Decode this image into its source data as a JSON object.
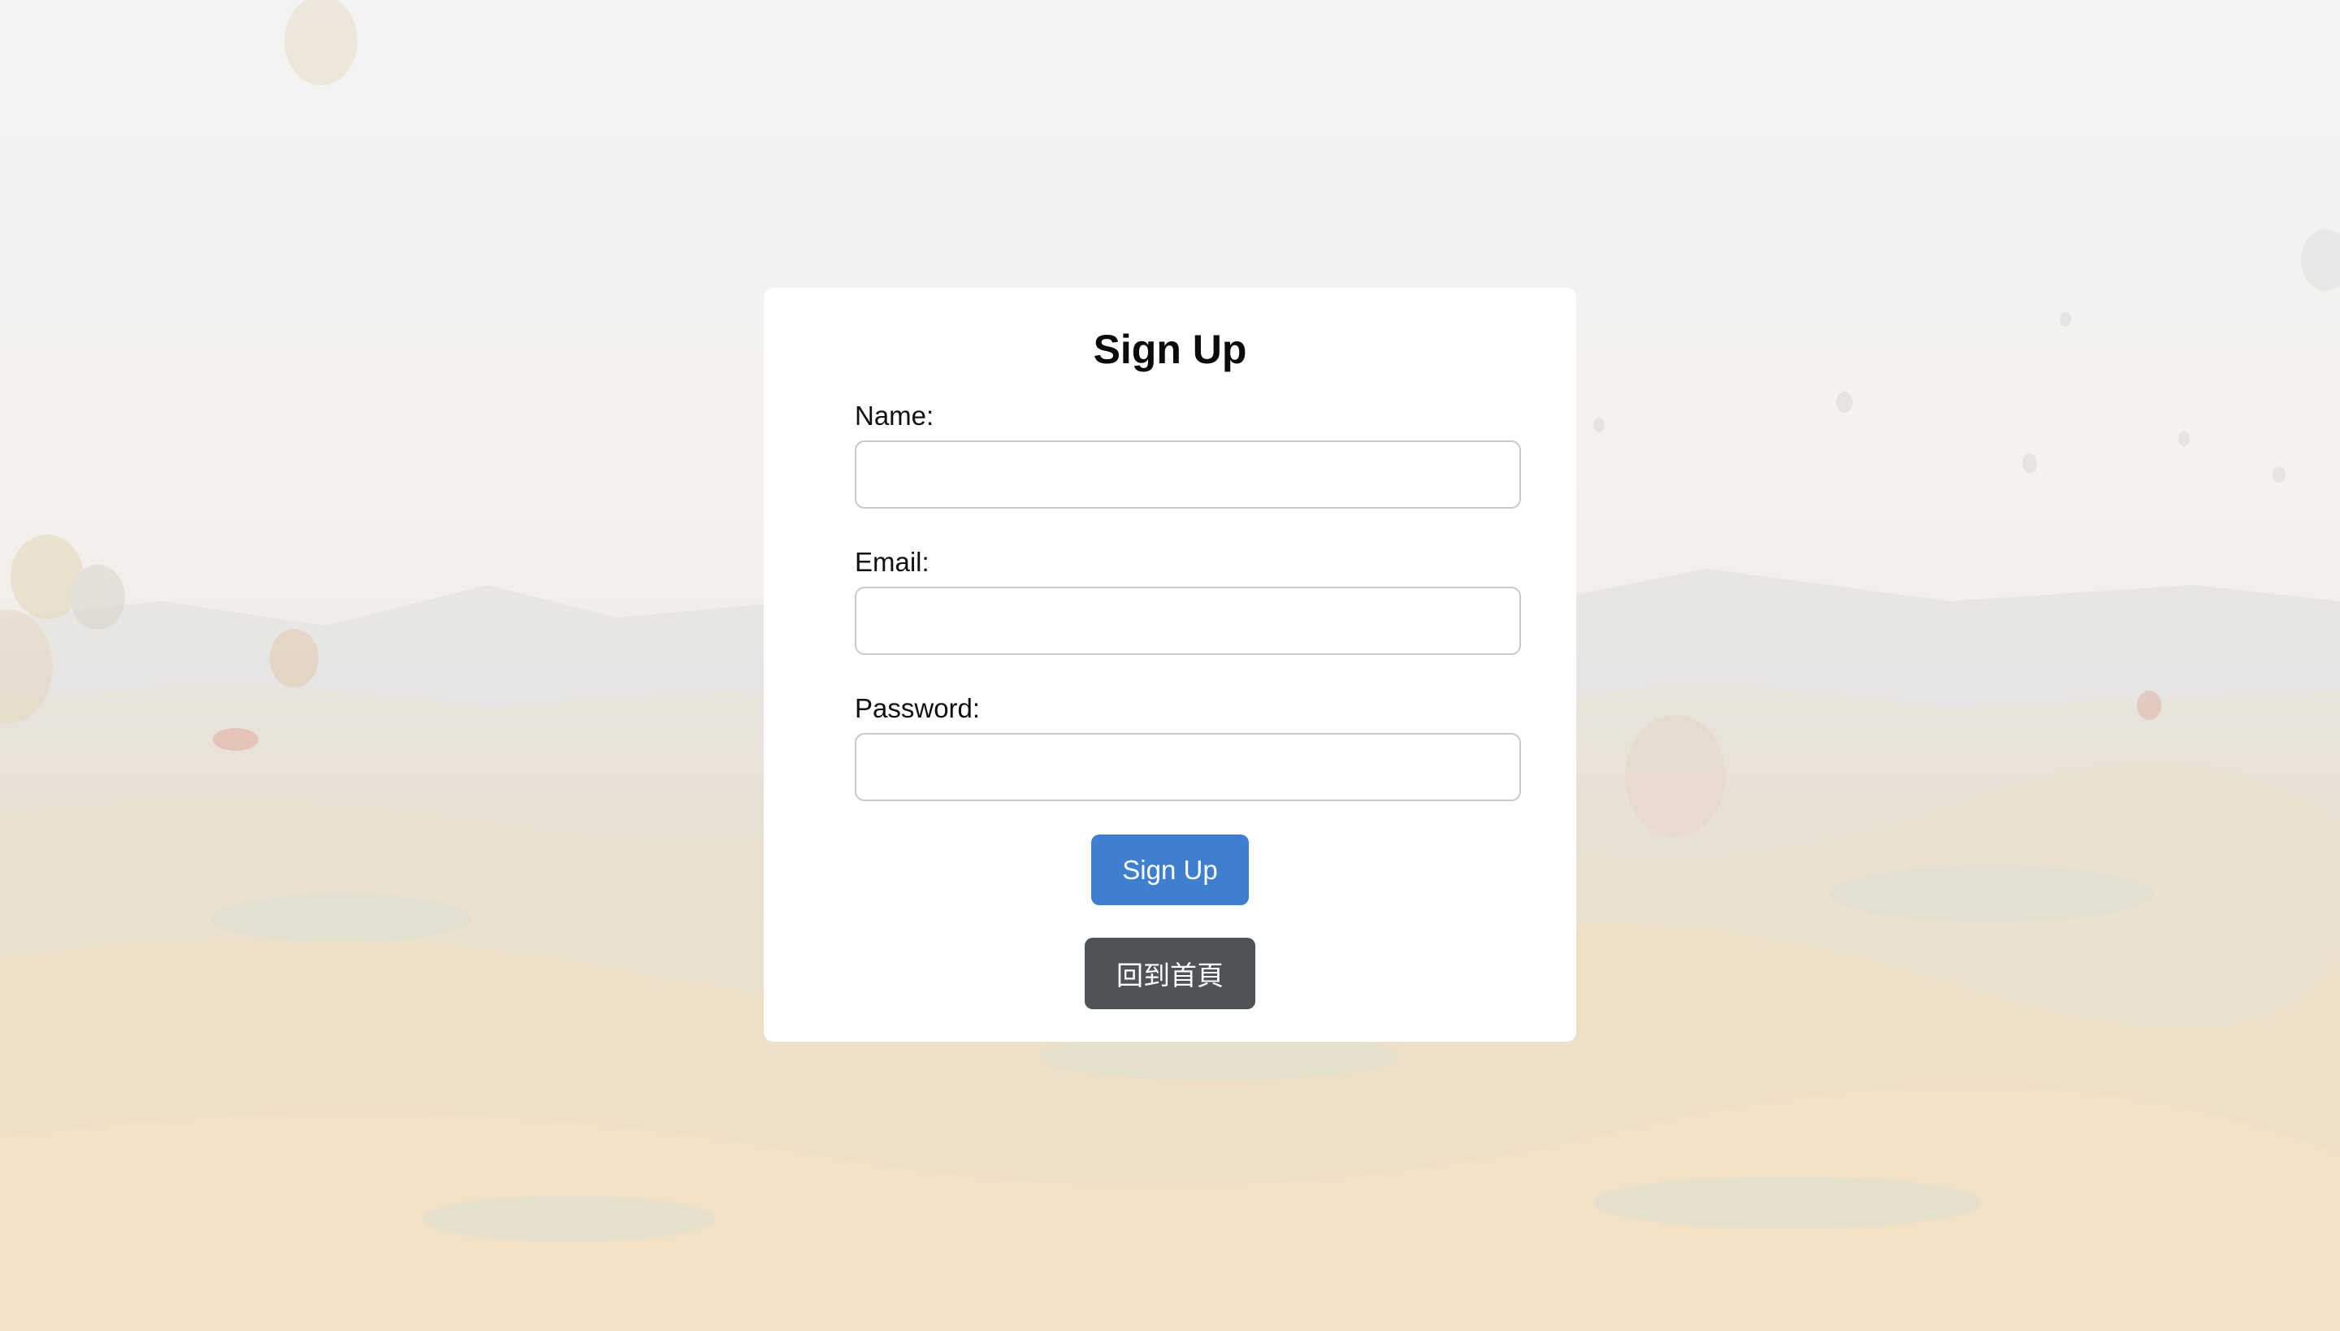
{
  "form": {
    "title": "Sign Up",
    "fields": [
      {
        "label": "Name:",
        "value": "",
        "placeholder": ""
      },
      {
        "label": "Email:",
        "value": "",
        "placeholder": ""
      },
      {
        "label": "Password:",
        "value": "",
        "placeholder": ""
      }
    ],
    "submit_label": "Sign Up",
    "home_label": "回到首頁"
  },
  "colors": {
    "primary_button": "#3f7fcf",
    "secondary_button": "#4f5357",
    "card_background": "#ffffff"
  },
  "background": {
    "description_icon": "hot-air-balloon-landscape-image"
  }
}
